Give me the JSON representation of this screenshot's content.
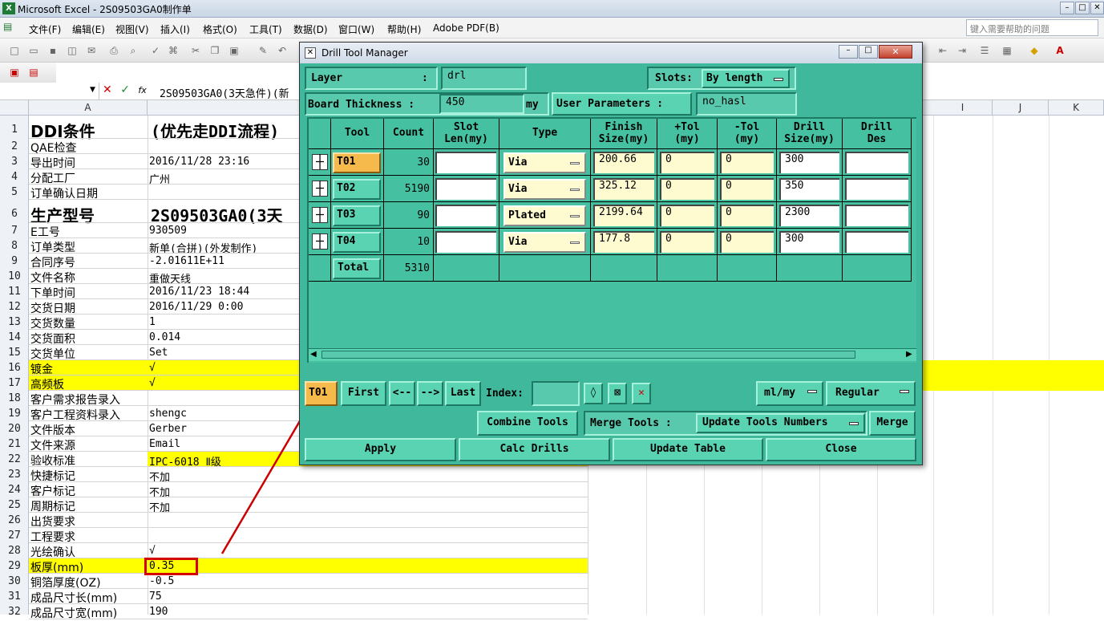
{
  "window": {
    "title": "Microsoft Excel - 2S09503GA0制作单",
    "min": "–",
    "max": "□",
    "close": "✕"
  },
  "menu": [
    "文件(F)",
    "编辑(E)",
    "视图(V)",
    "插入(I)",
    "格式(O)",
    "工具(T)",
    "数据(D)",
    "窗口(W)",
    "帮助(H)",
    "Adobe PDF(B)"
  ],
  "help_placeholder": "键入需要帮助的问题",
  "formula": {
    "namebox": "",
    "fx": "fx",
    "text": "2S09503GA0(3天急件)(新"
  },
  "columns": [
    "A",
    "I",
    "J",
    "K"
  ],
  "rows": [
    {
      "n": "1",
      "a": "DDI条件",
      "b": "(优先走DDI流程)"
    },
    {
      "n": "2",
      "a": "QAE检查",
      "b": ""
    },
    {
      "n": "3",
      "a": "导出时间",
      "b": "2016/11/28 23:16"
    },
    {
      "n": "4",
      "a": "分配工厂",
      "b": "广州"
    },
    {
      "n": "5",
      "a": "订单确认日期",
      "b": ""
    },
    {
      "n": "6",
      "a": "生产型号",
      "b": "2S09503GA0(3天"
    },
    {
      "n": "7",
      "a": "E工号",
      "b": "930509"
    },
    {
      "n": "8",
      "a": "订单类型",
      "b": "新单(合拼)(外发制作)"
    },
    {
      "n": "9",
      "a": "合同序号",
      "b": "-2.01611E+11"
    },
    {
      "n": "10",
      "a": "文件名称",
      "b": "重做天线"
    },
    {
      "n": "11",
      "a": "下单时间",
      "b": "2016/11/23 18:44"
    },
    {
      "n": "12",
      "a": "交货日期",
      "b": "2016/11/29 0:00"
    },
    {
      "n": "13",
      "a": "交货数量",
      "b": "1"
    },
    {
      "n": "14",
      "a": "交货面积",
      "b": "0.014"
    },
    {
      "n": "15",
      "a": "交货单位",
      "b": "Set"
    },
    {
      "n": "16",
      "a": "镀金",
      "b": "√"
    },
    {
      "n": "17",
      "a": "高频板",
      "b": "√"
    },
    {
      "n": "18",
      "a": "客户需求报告录入",
      "b": ""
    },
    {
      "n": "19",
      "a": "客户工程资料录入",
      "b": "shengc"
    },
    {
      "n": "20",
      "a": "文件版本",
      "b": "Gerber"
    },
    {
      "n": "21",
      "a": "文件来源",
      "b": "Email"
    },
    {
      "n": "22",
      "a": "验收标准",
      "b": "IPC-6018 Ⅱ级"
    },
    {
      "n": "23",
      "a": "快捷标记",
      "b": "不加"
    },
    {
      "n": "24",
      "a": "客户标记",
      "b": "不加"
    },
    {
      "n": "25",
      "a": "周期标记",
      "b": "不加"
    },
    {
      "n": "26",
      "a": "出货要求",
      "b": ""
    },
    {
      "n": "27",
      "a": "工程要求",
      "b": ""
    },
    {
      "n": "28",
      "a": "光绘确认",
      "b": "√"
    },
    {
      "n": "29",
      "a": "板厚(mm)",
      "b": "0.35"
    },
    {
      "n": "30",
      "a": "铜箔厚度(OZ)",
      "b": "-0.5"
    },
    {
      "n": "31",
      "a": "成品尺寸长(mm)",
      "b": "75"
    },
    {
      "n": "32",
      "a": "成品尺寸宽(mm)",
      "b": "190"
    }
  ],
  "dialog": {
    "title": "Drill Tool Manager",
    "layer_label": "Layer",
    "layer_colon": ":",
    "layer_value": "drl",
    "slots_label": "Slots:",
    "slots_value": "By length",
    "board_label": "Board Thickness :",
    "board_value": "450",
    "board_unit": "my",
    "user_params_label": "User Parameters :",
    "user_params_value": "no_hasl",
    "headers": [
      "Tool",
      "Count",
      "Slot\nLen(my)",
      "Type",
      "Finish\nSize(my)",
      "+Tol\n(my)",
      "-Tol\n(my)",
      "Drill\nSize(my)",
      "Drill\nDes"
    ],
    "tools": [
      {
        "tool": "T01",
        "count": "30",
        "slot": "",
        "type": "Via",
        "finish": "200.66",
        "ptol": "0",
        "ntol": "0",
        "drill": "300",
        "des": ""
      },
      {
        "tool": "T02",
        "count": "5190",
        "slot": "",
        "type": "Via",
        "finish": "325.12",
        "ptol": "0",
        "ntol": "0",
        "drill": "350",
        "des": ""
      },
      {
        "tool": "T03",
        "count": "90",
        "slot": "",
        "type": "Plated",
        "finish": "2199.64",
        "ptol": "0",
        "ntol": "0",
        "drill": "2300",
        "des": ""
      },
      {
        "tool": "T04",
        "count": "10",
        "slot": "",
        "type": "Via",
        "finish": "177.8",
        "ptol": "0",
        "ntol": "0",
        "drill": "300",
        "des": ""
      }
    ],
    "total_label": "Total",
    "total_value": "5310",
    "nav": {
      "current": "T01",
      "first": "First",
      "prev": "<--",
      "next": "-->",
      "last": "Last",
      "index": "Index:",
      "units": "ml/my",
      "mode": "Regular"
    },
    "buttons": {
      "combine": "Combine Tools",
      "merge_label": "Merge Tools :",
      "update_numbers": "Update Tools Numbers",
      "merge": "Merge",
      "apply": "Apply",
      "calc": "Calc Drills",
      "update_table": "Update Table",
      "close": "Close"
    }
  },
  "colors": {
    "dialog_bg": "#3fb89c",
    "highlight": "#ffff00",
    "arrow": "#cc0000"
  }
}
